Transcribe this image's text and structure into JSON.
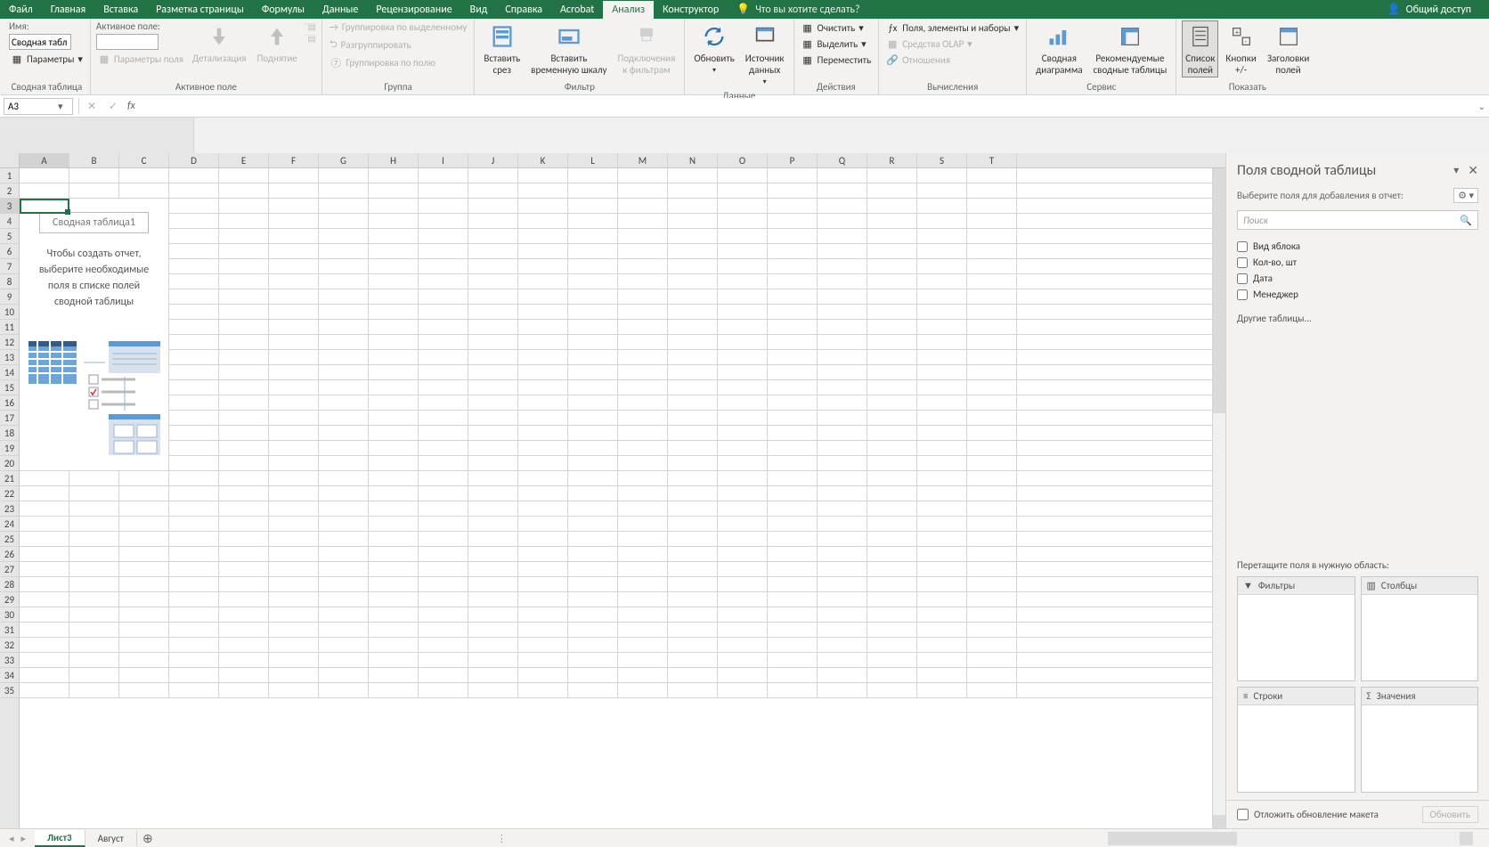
{
  "menu": {
    "items": [
      "Файл",
      "Главная",
      "Вставка",
      "Разметка страницы",
      "Формулы",
      "Данные",
      "Рецензирование",
      "Вид",
      "Справка",
      "Acrobat",
      "Анализ",
      "Конструктор"
    ],
    "active_index": 10,
    "tell_me": "Что вы хотите сделать?",
    "share": "Общий доступ"
  },
  "ribbon": {
    "pivot": {
      "name_label": "Имя:",
      "name_value": "Сводная табл",
      "options": "Параметры",
      "group_label": "Сводная таблица"
    },
    "active_field": {
      "label": "Активное поле:",
      "value": "",
      "field_params": "Параметры поля",
      "drill": "Детализация",
      "collapse": "Поднятие",
      "group_label": "Активное поле"
    },
    "group": {
      "by_selection": "Группировка по выделенному",
      "ungroup": "Разгруппировать",
      "by_field": "Группировка по полю",
      "group_label": "Группа"
    },
    "filter": {
      "slicer": "Вставить\nсрез",
      "timeline": "Вставить\nвременную шкалу",
      "connections": "Подключения\nк фильтрам",
      "group_label": "Фильтр"
    },
    "data": {
      "refresh": "Обновить",
      "source": "Источник\nданных",
      "group_label": "Данные"
    },
    "actions": {
      "clear": "Очистить",
      "select": "Выделить",
      "move": "Переместить",
      "group_label": "Действия"
    },
    "calc": {
      "fields": "Поля, элементы и наборы",
      "olap": "Средства OLAP",
      "relations": "Отношения",
      "group_label": "Вычисления"
    },
    "tools": {
      "chart": "Сводная\nдиаграмма",
      "recommend": "Рекомендуемые\nсводные таблицы",
      "group_label": "Сервис"
    },
    "show": {
      "field_list": "Список\nполей",
      "buttons": "Кнопки\n+/-",
      "headers": "Заголовки\nполей",
      "group_label": "Показать"
    }
  },
  "namebox": "A3",
  "columns": [
    "A",
    "B",
    "C",
    "D",
    "E",
    "F",
    "G",
    "H",
    "I",
    "J",
    "K",
    "L",
    "M",
    "N",
    "O",
    "P",
    "Q",
    "R",
    "S",
    "T"
  ],
  "rows": [
    "1",
    "2",
    "3",
    "4",
    "5",
    "6",
    "7",
    "8",
    "9",
    "10",
    "11",
    "12",
    "13",
    "14",
    "15",
    "16",
    "17",
    "18",
    "19",
    "20",
    "21",
    "22",
    "23",
    "24",
    "25",
    "26",
    "27",
    "28",
    "29",
    "30",
    "31",
    "32",
    "33",
    "34",
    "35"
  ],
  "pivot_placeholder": {
    "title": "Сводная таблица1",
    "text": "Чтобы создать отчет, выберите необходимые поля в списке полей сводной таблицы"
  },
  "sheet_tabs": {
    "tabs": [
      "Лист3",
      "Август"
    ],
    "active_index": 0
  },
  "pane": {
    "title": "Поля сводной таблицы",
    "choose": "Выберите поля для добавления в отчет:",
    "search_placeholder": "Поиск",
    "fields": [
      "Вид яблока",
      "Кол-во, шт",
      "Дата",
      "Менеджер"
    ],
    "other_tables": "Другие таблицы...",
    "drag_label": "Перетащите поля в нужную область:",
    "areas": {
      "filters": "Фильтры",
      "columns": "Столбцы",
      "rows": "Строки",
      "values": "Значения"
    },
    "defer": "Отложить обновление макета",
    "update": "Обновить"
  }
}
